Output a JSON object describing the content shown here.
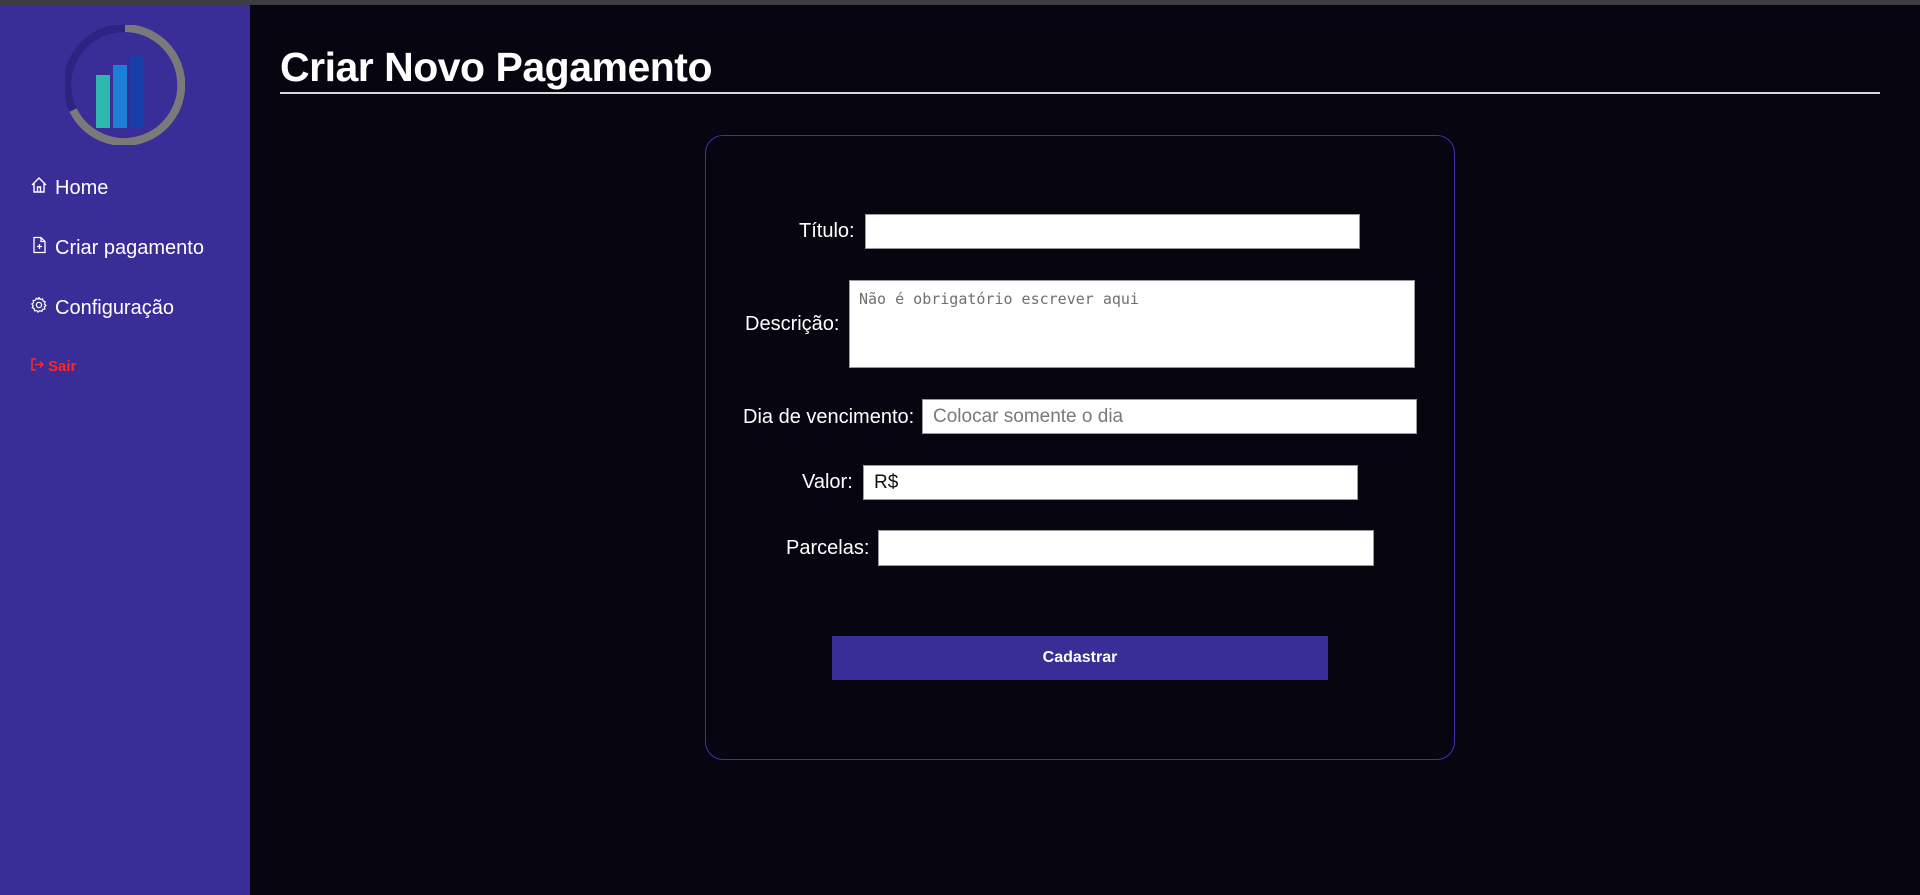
{
  "sidebar": {
    "logo_icon": "bar-chart-logo-icon",
    "items": [
      {
        "label": "Home",
        "icon": "home-icon"
      },
      {
        "label": "Criar pagamento",
        "icon": "file-plus-icon"
      },
      {
        "label": "Configuração",
        "icon": "gear-icon"
      }
    ],
    "logout": {
      "label": "Sair",
      "icon": "logout-icon",
      "color": "#ff2626"
    }
  },
  "main": {
    "title": "Criar Novo Pagamento"
  },
  "form": {
    "titulo": {
      "label": "Título:",
      "value": "",
      "placeholder": ""
    },
    "descricao": {
      "label": "Descrição:",
      "value": "",
      "placeholder": "Não é obrigatório escrever aqui"
    },
    "vencimento": {
      "label": "Dia de vencimento:",
      "value": "",
      "placeholder": "Colocar somente o dia"
    },
    "valor": {
      "label": "Valor:",
      "value": "R$",
      "placeholder": ""
    },
    "parcelas": {
      "label": "Parcelas:",
      "value": "",
      "placeholder": ""
    },
    "submit_label": "Cadastrar"
  },
  "colors": {
    "sidebar_bg": "#392d97",
    "page_bg": "#07050f",
    "accent": "#392d97",
    "logout": "#ff2626"
  }
}
